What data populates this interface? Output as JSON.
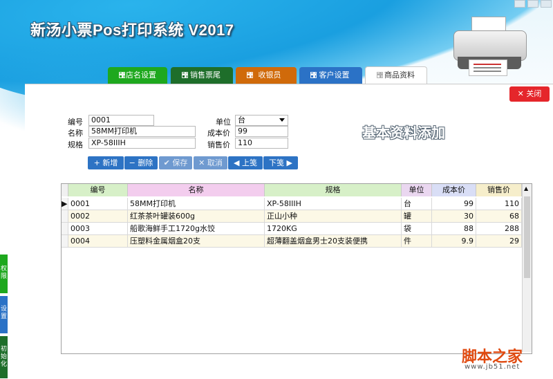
{
  "app": {
    "title": "新汤小票Pos打印系统 V2017"
  },
  "tabs": [
    {
      "label": "店名设置",
      "color": "#1ea81e"
    },
    {
      "label": "销售票尾",
      "color": "#1e6e2a"
    },
    {
      "label": "收银员",
      "color": "#d06a0a"
    },
    {
      "label": "客户设置",
      "color": "#2b72c6"
    },
    {
      "label": "商品资料",
      "color": "#ffffff"
    }
  ],
  "close_button": {
    "label": "关闭",
    "icon": "close-icon"
  },
  "form": {
    "code": {
      "label": "编号",
      "value": "0001"
    },
    "name": {
      "label": "名称",
      "value": "58MM打印机"
    },
    "spec": {
      "label": "规格",
      "value": "XP-58IIIH"
    },
    "unit": {
      "label": "单位",
      "value": "台"
    },
    "cost": {
      "label": "成本价",
      "value": "99"
    },
    "price": {
      "label": "销售价",
      "value": "110"
    }
  },
  "section_title": "基本资料添加",
  "buttons": {
    "add": "新增",
    "delete": "删除",
    "save": "保存",
    "cancel": "取消",
    "prev": "上笺",
    "next": "下笺"
  },
  "table": {
    "headers": [
      "编号",
      "名称",
      "规格",
      "单位",
      "成本价",
      "销售价"
    ],
    "header_colors": [
      "#d7f0c8",
      "#f3cdee",
      "#d7f0c8",
      "#ead7f0",
      "#d9def6",
      "#f6eecb"
    ],
    "rows": [
      [
        "0001",
        "58MM打印机",
        "XP-58IIIH",
        "台",
        "99",
        "110"
      ],
      [
        "0002",
        "红茶茶叶罐装600g",
        "正山小种",
        "罐",
        "30",
        "68"
      ],
      [
        "0003",
        "船歌海鲜手工1720g水饺",
        "1720KG",
        "袋",
        "88",
        "288"
      ],
      [
        "0004",
        "压塑料金属烟盒20支",
        "超薄翻盖烟盒男士20支装便携",
        "件",
        "9.9",
        "29"
      ]
    ]
  },
  "side_tabs": [
    "权限",
    "设置",
    "初始化"
  ],
  "watermark": {
    "text": "脚本之家",
    "sub": "www.jb51.net"
  }
}
